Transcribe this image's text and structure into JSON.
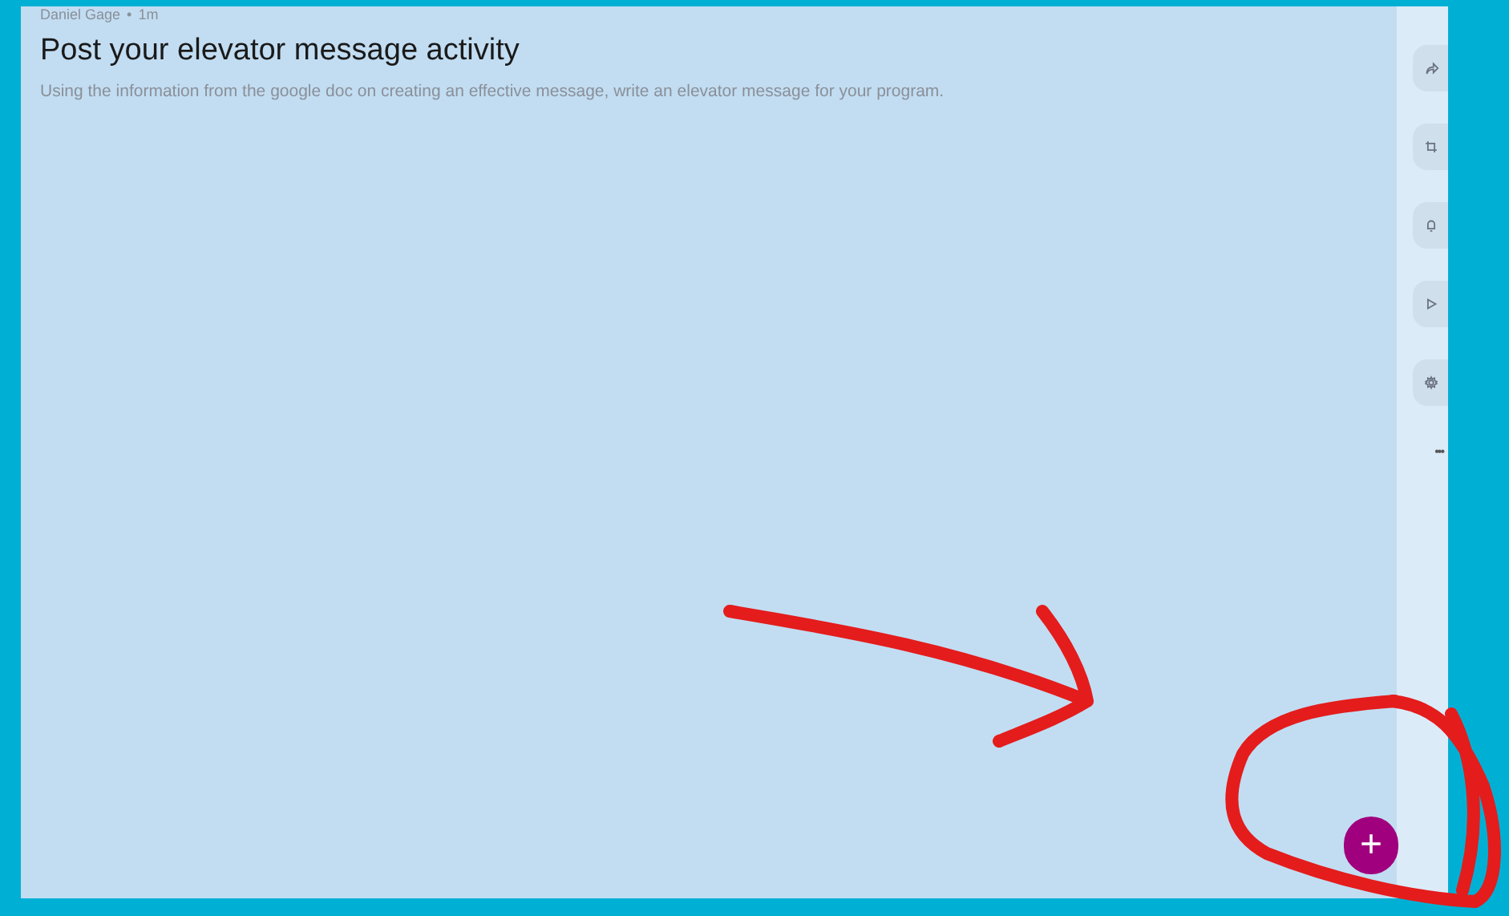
{
  "post": {
    "author": "Daniel Gage",
    "separator": "•",
    "time": "1m",
    "title": "Post your elevator message activity",
    "description": "Using the information from the google doc on creating an effective message, write an elevator message for your program."
  },
  "sidebar": {
    "buttons": [
      {
        "kind": "share"
      },
      {
        "kind": "crop"
      },
      {
        "kind": "bell"
      },
      {
        "kind": "play"
      },
      {
        "kind": "gear"
      }
    ],
    "more": "•••"
  },
  "fab": {
    "label": "+"
  }
}
